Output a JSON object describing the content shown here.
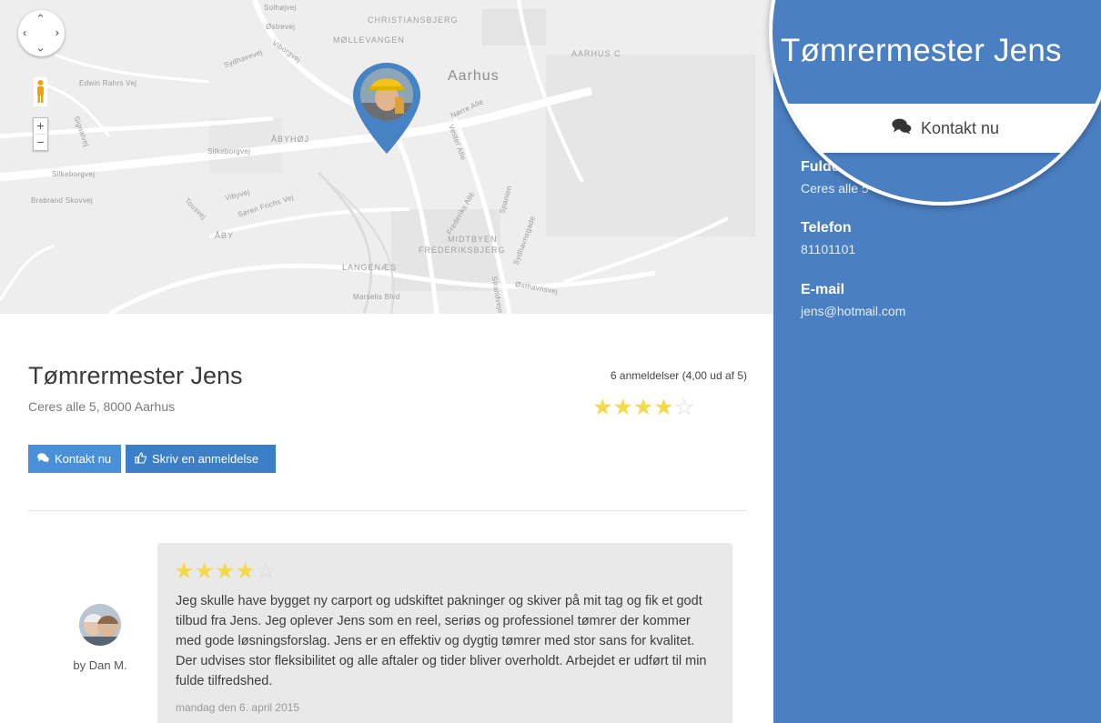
{
  "map": {
    "labels": {
      "solhoj": "Solhøjvej",
      "ostrevej": "Østrevej",
      "christiansbjerg": "CHRISTIANSBJERG",
      "mollevangen": "MØLLEVANGEN",
      "aarhus_c": "AARHUS C",
      "sydhavevej": "Sydhavevej",
      "viborgvej": "Viborgvej",
      "aarhus": "Aarhus",
      "edwin": "Edwin Rahrs Vej",
      "norre_alle": "Nørre Alle",
      "signalvej": "Signalvej",
      "abyhoj": "ÅBYHØJ",
      "vester_alle": "Vester Alle",
      "silkeborgvej_1": "Silkeborgvej",
      "silkeborgvej_2": "Silkeborgvej",
      "brabrand": "Brabrand Skovvej",
      "vibyvej": "Vibyvej",
      "soren": "Søren Frichs Vej",
      "tousvej": "Tousvej",
      "frederiks_alle": "Frederiks Allé",
      "spanien": "Spanien",
      "midtbyen": "MIDTBYEN",
      "frederiksbjerg": "FREDERIKSBJERG",
      "sydhavnsgade": "Sydhavnsgade",
      "aby": "ÅBY",
      "langenaes": "LANGENÆS",
      "marselis": "Marselis Blvd",
      "osthavnsvej": "Østhavnsvej",
      "strand": "Strandvejen"
    },
    "zoom_in": "+",
    "zoom_out": "−",
    "pin_icon": "location-pin-icon"
  },
  "profile": {
    "name": "Tømrermester Jens",
    "address": "Ceres alle 5, 8000 Aarhus",
    "review_count": "6 anmeldelser (4,00 ud af 5)",
    "rating": 4,
    "rating_max": 5,
    "contact_label": "Kontakt nu",
    "review_label": "Skriv en anmeldelse"
  },
  "review": {
    "rating": 4,
    "text": "Jeg skulle have bygget ny carport og udskiftet pakninger og skiver på mit tag og fik et godt tilbud fra Jens. Jeg oplever Jens som en reel, seriøs og professionel tømrer der kommer med gode løsningsforslag. Jens er en effektiv og dygtig tømrer med stor sans for kvalitet. Der udvises stor fleksibilitet og alle aftaler og tider bliver overholdt. Arbejdet er udført til min fulde tilfredshed.",
    "date": "mandag den 6. april 2015",
    "author": "by Dan M."
  },
  "sidebar": {
    "fulde_label_partial": "Fulde",
    "address_partial": "Ceres alle 5",
    "phone_label": "Telefon",
    "phone": "81101101",
    "email_label": "E-mail",
    "email": "jens@hotmail.com"
  },
  "magnifier": {
    "title": "Tømrermester Jens",
    "contact_label": "Kontakt nu"
  },
  "colors": {
    "sidebar": "#4a7fc1",
    "button_contact": "#4a90d9",
    "button_review": "#3d7fc7",
    "star": "#f5d94a",
    "map_bg": "#f0f0f0"
  }
}
